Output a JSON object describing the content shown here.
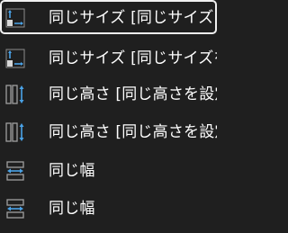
{
  "menu": {
    "items": [
      {
        "label": "同じサイズ [同じサイズを設定]",
        "icon": "same-size-icon",
        "selected": true
      },
      {
        "label": "同じサイズ [同じサイズを設定]",
        "icon": "same-size-icon",
        "selected": false
      },
      {
        "label": "同じ高さ [同じ高さを設定]",
        "icon": "same-height-icon",
        "selected": false
      },
      {
        "label": "同じ高さ [同じ高さを設定]",
        "icon": "same-height-icon",
        "selected": false
      },
      {
        "label": "同じ幅",
        "icon": "same-width-icon",
        "selected": false
      },
      {
        "label": "同じ幅",
        "icon": "same-width-icon",
        "selected": false
      }
    ]
  },
  "colors": {
    "background": "#1f1f1f",
    "text": "#ffffff",
    "accent_blue": "#4aa3e8",
    "icon_gray": "#a0a0a0",
    "selection_border": "#f0f0f0"
  }
}
